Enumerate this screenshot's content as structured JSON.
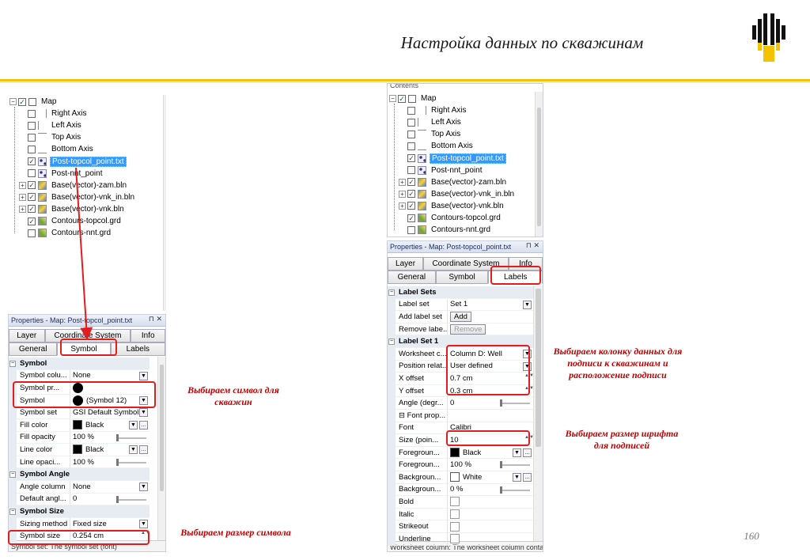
{
  "slide": {
    "title": "Настройка данных по скважинам",
    "page_number": "160",
    "brand_color": "#f3c300",
    "accent_red": "#e21d1d"
  },
  "annotations": {
    "symbol": "Выбираем символ для скважин",
    "size": "Выбираем размер символа",
    "column": "Выбираем колонку данных для подписи к скважинам и расположение подписи",
    "font": "Выбираем размер шрифта для подписей"
  },
  "left": {
    "tree": {
      "items": [
        {
          "label": "Map",
          "checked": true
        },
        {
          "label": "Right Axis",
          "checked": false
        },
        {
          "label": "Left Axis",
          "checked": false
        },
        {
          "label": "Top Axis",
          "checked": false
        },
        {
          "label": "Bottom Axis",
          "checked": false
        },
        {
          "label": "Post-topcol_point.txt",
          "checked": true,
          "selected": true
        },
        {
          "label": "Post-nnt_point",
          "checked": false
        },
        {
          "label": "Base(vector)-zam.bln",
          "checked": true
        },
        {
          "label": "Base(vector)-vnk_in.bln",
          "checked": true
        },
        {
          "label": "Base(vector)-vnk.bln",
          "checked": true
        },
        {
          "label": "Contours-topcol.grd",
          "checked": true
        },
        {
          "label": "Contours-nnt.grd",
          "checked": false
        }
      ]
    },
    "props_title": "Properties - Map: Post-topcol_point.txt",
    "title_btns": "⊓ ✕",
    "tabs_row1": [
      "Layer",
      "Coordinate System",
      "Info"
    ],
    "tabs_row2": [
      "General",
      "Symbol",
      "Labels"
    ],
    "active_tab": "Symbol",
    "rows": [
      {
        "type": "section",
        "name": "Symbol"
      },
      {
        "name": "Symbol colu...",
        "value": "None"
      },
      {
        "name": "Symbol pr...",
        "value": ""
      },
      {
        "name": "Symbol",
        "value": "(Symbol 12)"
      },
      {
        "name": "Symbol set",
        "value": "GSI Default Symbols"
      },
      {
        "name": "Fill color",
        "value": "Black"
      },
      {
        "name": "Fill opacity",
        "value": "100 %"
      },
      {
        "name": "Line color",
        "value": "Black"
      },
      {
        "name": "Line opaci...",
        "value": "100 %"
      },
      {
        "type": "section",
        "name": "Symbol Angle"
      },
      {
        "name": "Angle column",
        "value": "None"
      },
      {
        "name": "Default angl...",
        "value": "0"
      },
      {
        "type": "section",
        "name": "Symbol Size"
      },
      {
        "name": "Sizing method",
        "value": "Fixed size"
      },
      {
        "name": "Symbol size",
        "value": "0.254 cm"
      }
    ],
    "status": "Symbol set: The symbol set (font)"
  },
  "right": {
    "contents_label": "Contents",
    "tree": {
      "items": [
        {
          "label": "Map",
          "checked": true
        },
        {
          "label": "Right Axis",
          "checked": false
        },
        {
          "label": "Left Axis",
          "checked": false
        },
        {
          "label": "Top Axis",
          "checked": false
        },
        {
          "label": "Bottom Axis",
          "checked": false
        },
        {
          "label": "Post-topcol_point.txt",
          "checked": true,
          "selected": true
        },
        {
          "label": "Post-nnt_point",
          "checked": false
        },
        {
          "label": "Base(vector)-zam.bln",
          "checked": true
        },
        {
          "label": "Base(vector)-vnk_in.bln",
          "checked": true
        },
        {
          "label": "Base(vector)-vnk.bln",
          "checked": true
        },
        {
          "label": "Contours-topcol.grd",
          "checked": true
        },
        {
          "label": "Contours-nnt.grd",
          "checked": false
        }
      ]
    },
    "props_title": "Properties - Map: Post-topcol_point.txt",
    "title_btns": "⊓ ✕",
    "tabs_row1": [
      "Layer",
      "Coordinate System",
      "Info"
    ],
    "tabs_row2": [
      "General",
      "Symbol",
      "Labels"
    ],
    "active_tab": "Labels",
    "rows": [
      {
        "type": "section",
        "name": "Label Sets"
      },
      {
        "name": "Label set",
        "value": "Set 1"
      },
      {
        "name": "Add label set",
        "value": "Add"
      },
      {
        "name": "Remove labe...",
        "value": "Remove"
      },
      {
        "type": "section",
        "name": "Label Set 1"
      },
      {
        "name": "Worksheet c...",
        "value": "Column D:  Well"
      },
      {
        "name": "Position relat...",
        "value": "User defined"
      },
      {
        "name": "X offset",
        "value": "0.7 cm"
      },
      {
        "name": "Y offset",
        "value": "0.3 cm"
      },
      {
        "name": "Angle (degr...",
        "value": "0"
      },
      {
        "type": "subsection",
        "name": "Font prop..."
      },
      {
        "name": "Font",
        "value": "Calibri"
      },
      {
        "name": "Size (poin...",
        "value": "10"
      },
      {
        "name": "Foregroun...",
        "value": "Black"
      },
      {
        "name": "Foregroun...",
        "value": "100 %"
      },
      {
        "name": "Backgroun...",
        "value": "White"
      },
      {
        "name": "Backgroun...",
        "value": "0 %"
      },
      {
        "name": "Bold",
        "value": ""
      },
      {
        "name": "Italic",
        "value": ""
      },
      {
        "name": "Strikeout",
        "value": ""
      },
      {
        "name": "Underline",
        "value": ""
      }
    ],
    "status": "Worksheet column: The worksheet column containing the label text"
  }
}
